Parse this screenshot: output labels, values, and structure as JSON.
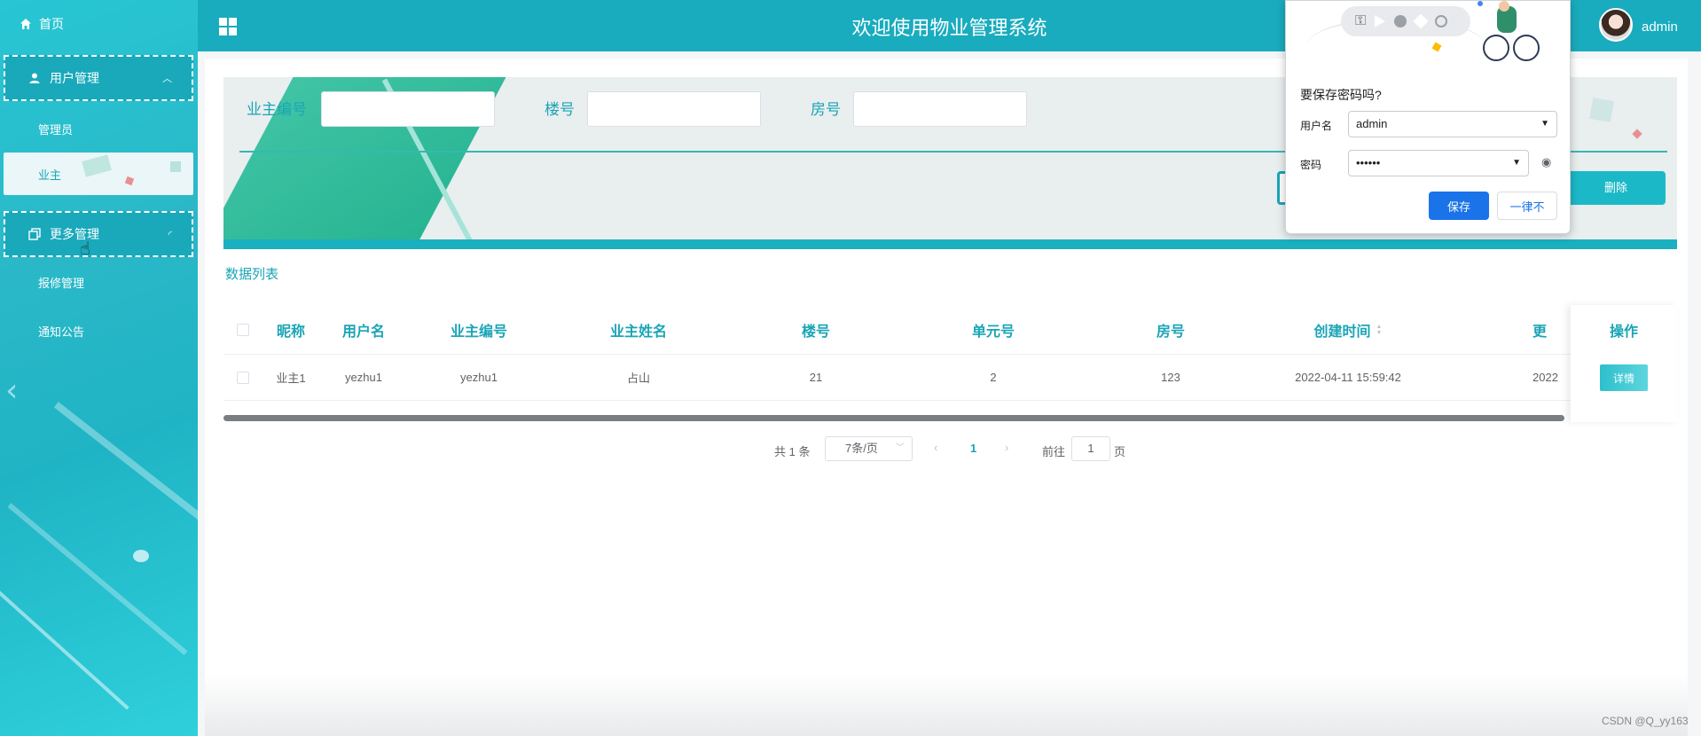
{
  "sidebar": {
    "home_label": "首页",
    "groups": [
      {
        "label": "用户管理",
        "items": [
          "管理员",
          "业主"
        ]
      },
      {
        "label": "更多管理",
        "items": [
          "报修管理",
          "通知公告"
        ]
      }
    ],
    "active_item": "业主"
  },
  "header": {
    "title": "欢迎使用物业管理系统",
    "user_name": "admin"
  },
  "search": {
    "fields": [
      {
        "label": "业主编号",
        "value": ""
      },
      {
        "label": "楼号",
        "value": ""
      },
      {
        "label": "房号",
        "value": ""
      }
    ],
    "delete_label": "删除"
  },
  "list": {
    "title": "数据列表",
    "columns": [
      "昵称",
      "用户名",
      "业主编号",
      "业主姓名",
      "楼号",
      "单元号",
      "房号",
      "创建时间",
      "更",
      "操作"
    ],
    "rows": [
      {
        "nickname": "业主1",
        "username": "yezhu1",
        "owner_no": "yezhu1",
        "owner_name": "占山",
        "building": "21",
        "unit": "2",
        "room": "123",
        "created": "2022-04-11 15:59:42",
        "updated": "2022",
        "action": "详情"
      }
    ]
  },
  "pagination": {
    "total": "共 1 条",
    "page_size": "7条/页",
    "current_page": "1",
    "goto_label": "前往",
    "goto_value": "1",
    "page_unit": "页"
  },
  "password_popup": {
    "title": "要保存密码吗?",
    "username_label": "用户名",
    "username_value": "admin",
    "password_label": "密码",
    "password_value": "••••••",
    "save_label": "保存",
    "never_label": "一律不"
  },
  "watermark": "CSDN @Q_yy163",
  "colors": {
    "primary": "#1aa5b6",
    "header": "#19acbe",
    "popup_button": "#1a73e8"
  }
}
